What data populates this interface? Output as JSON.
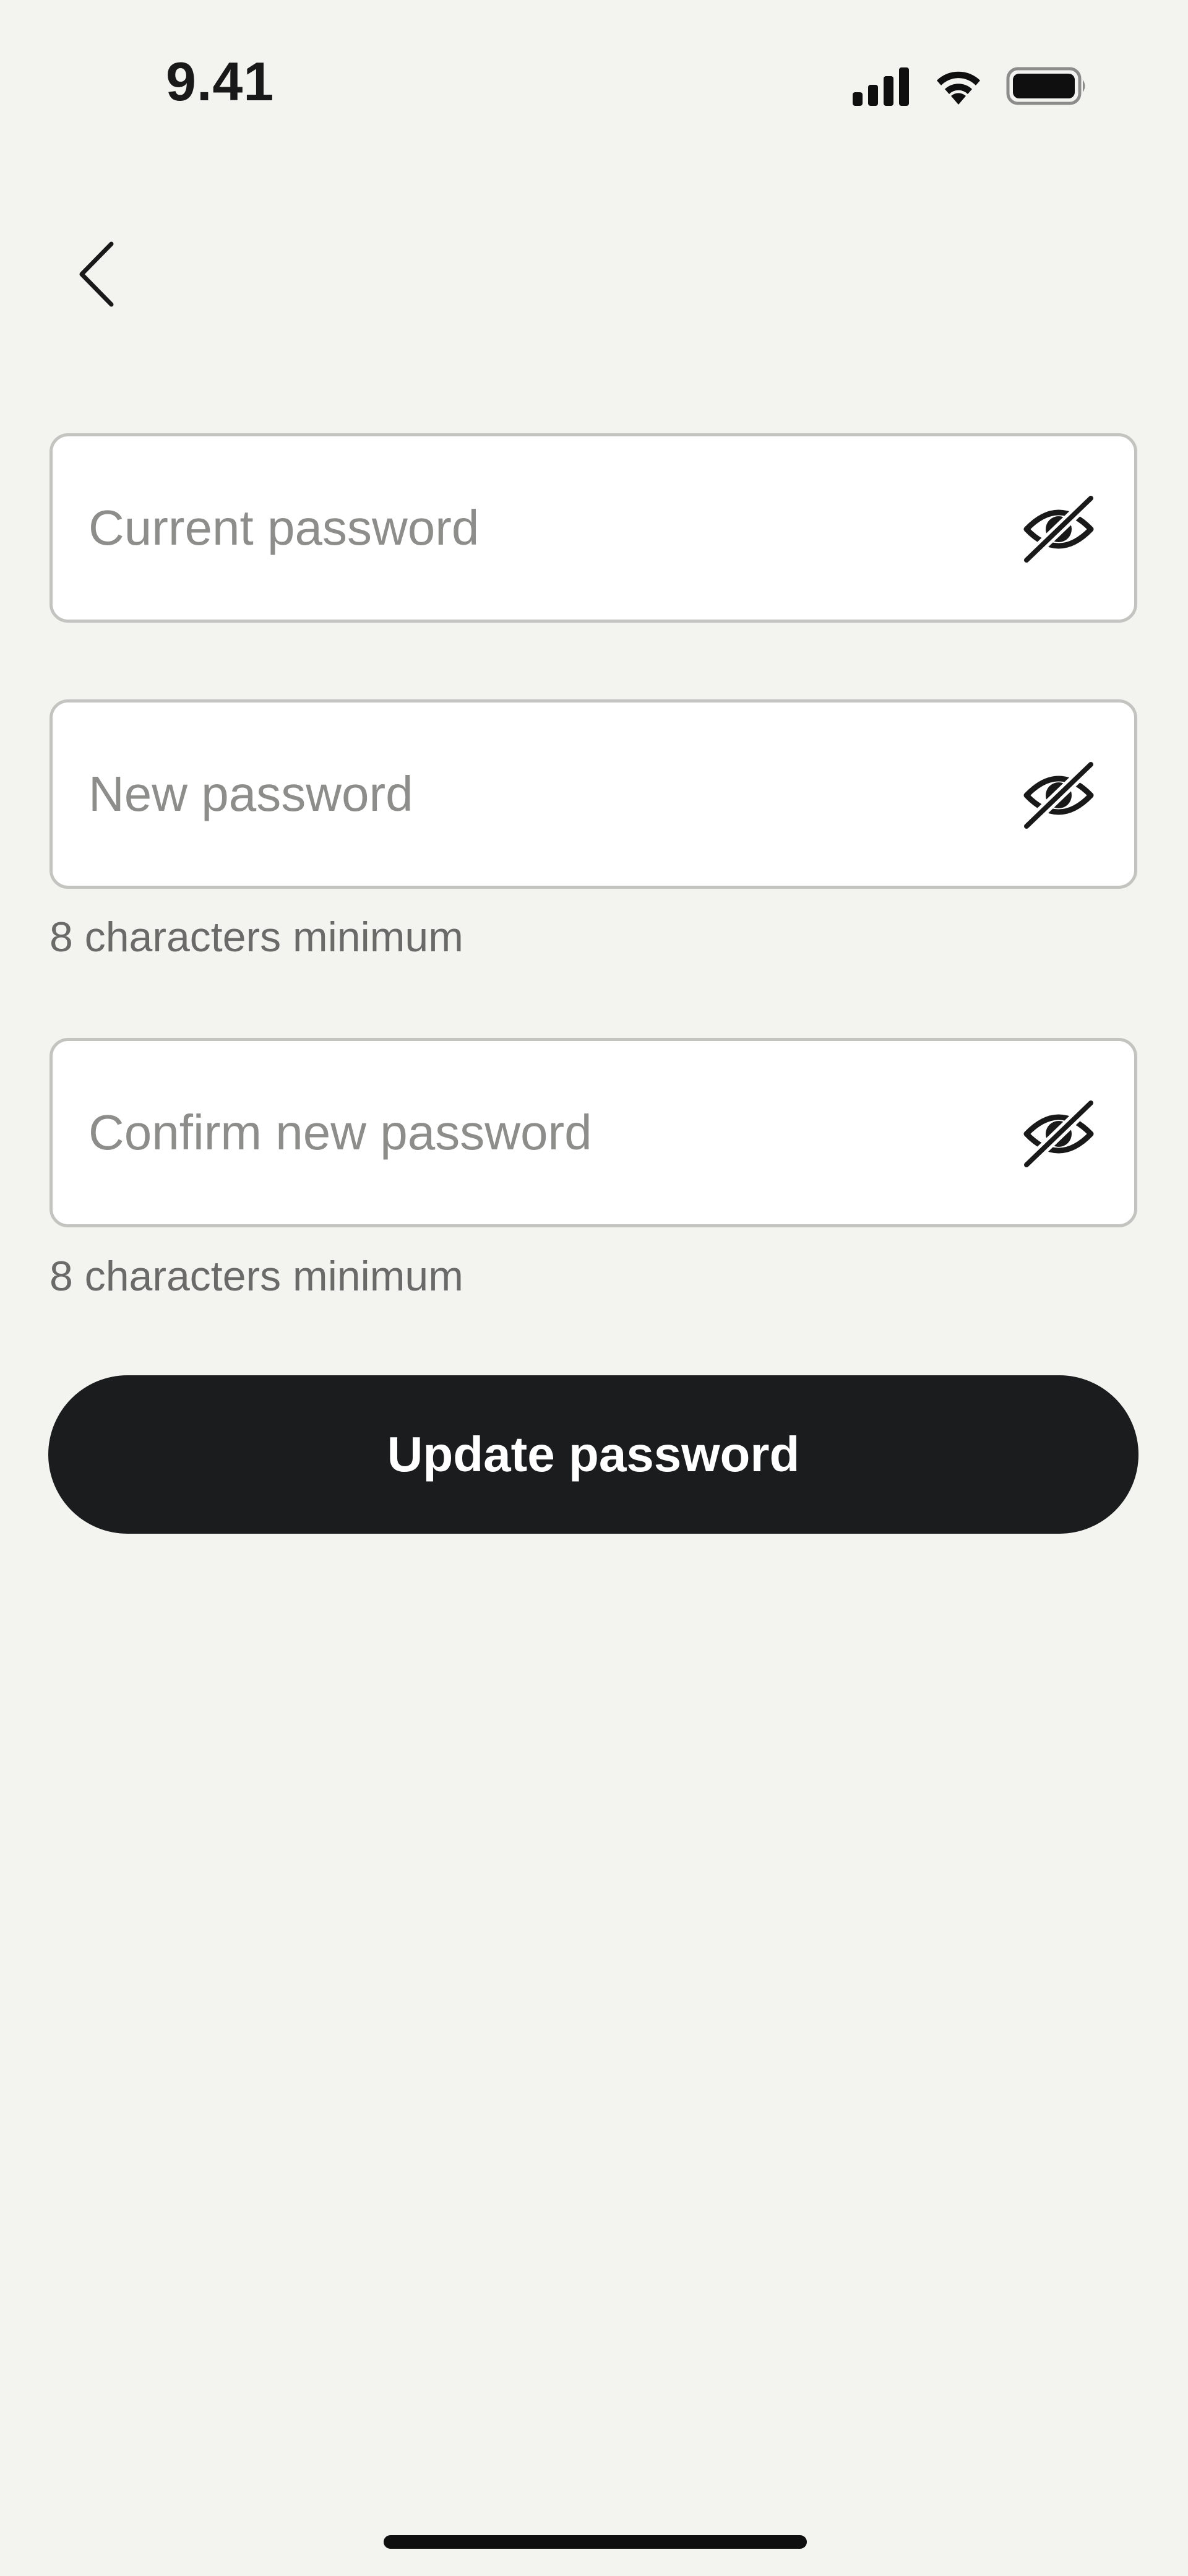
{
  "status_bar": {
    "time": "9.41",
    "icons": [
      "cellular-signal-icon",
      "wifi-icon",
      "battery-icon"
    ]
  },
  "navigation": {
    "back_icon": "chevron-left-icon"
  },
  "form": {
    "current_password": {
      "placeholder": "Current password",
      "value": "",
      "toggle_icon": "eye-off-icon"
    },
    "new_password": {
      "placeholder": "New password",
      "value": "",
      "hint": "8 characters minimum",
      "toggle_icon": "eye-off-icon"
    },
    "confirm_password": {
      "placeholder": "Confirm new password",
      "value": "",
      "hint": "8 characters minimum",
      "toggle_icon": "eye-off-icon"
    },
    "submit_label": "Update password"
  },
  "colors": {
    "background": "#f3f3ef",
    "field_background": "#ffffff",
    "field_border": "#c3c3c0",
    "placeholder": "#8d8d8b",
    "hint_text": "#6a6a68",
    "button_background": "#1b1c1e",
    "button_text": "#ffffff"
  }
}
